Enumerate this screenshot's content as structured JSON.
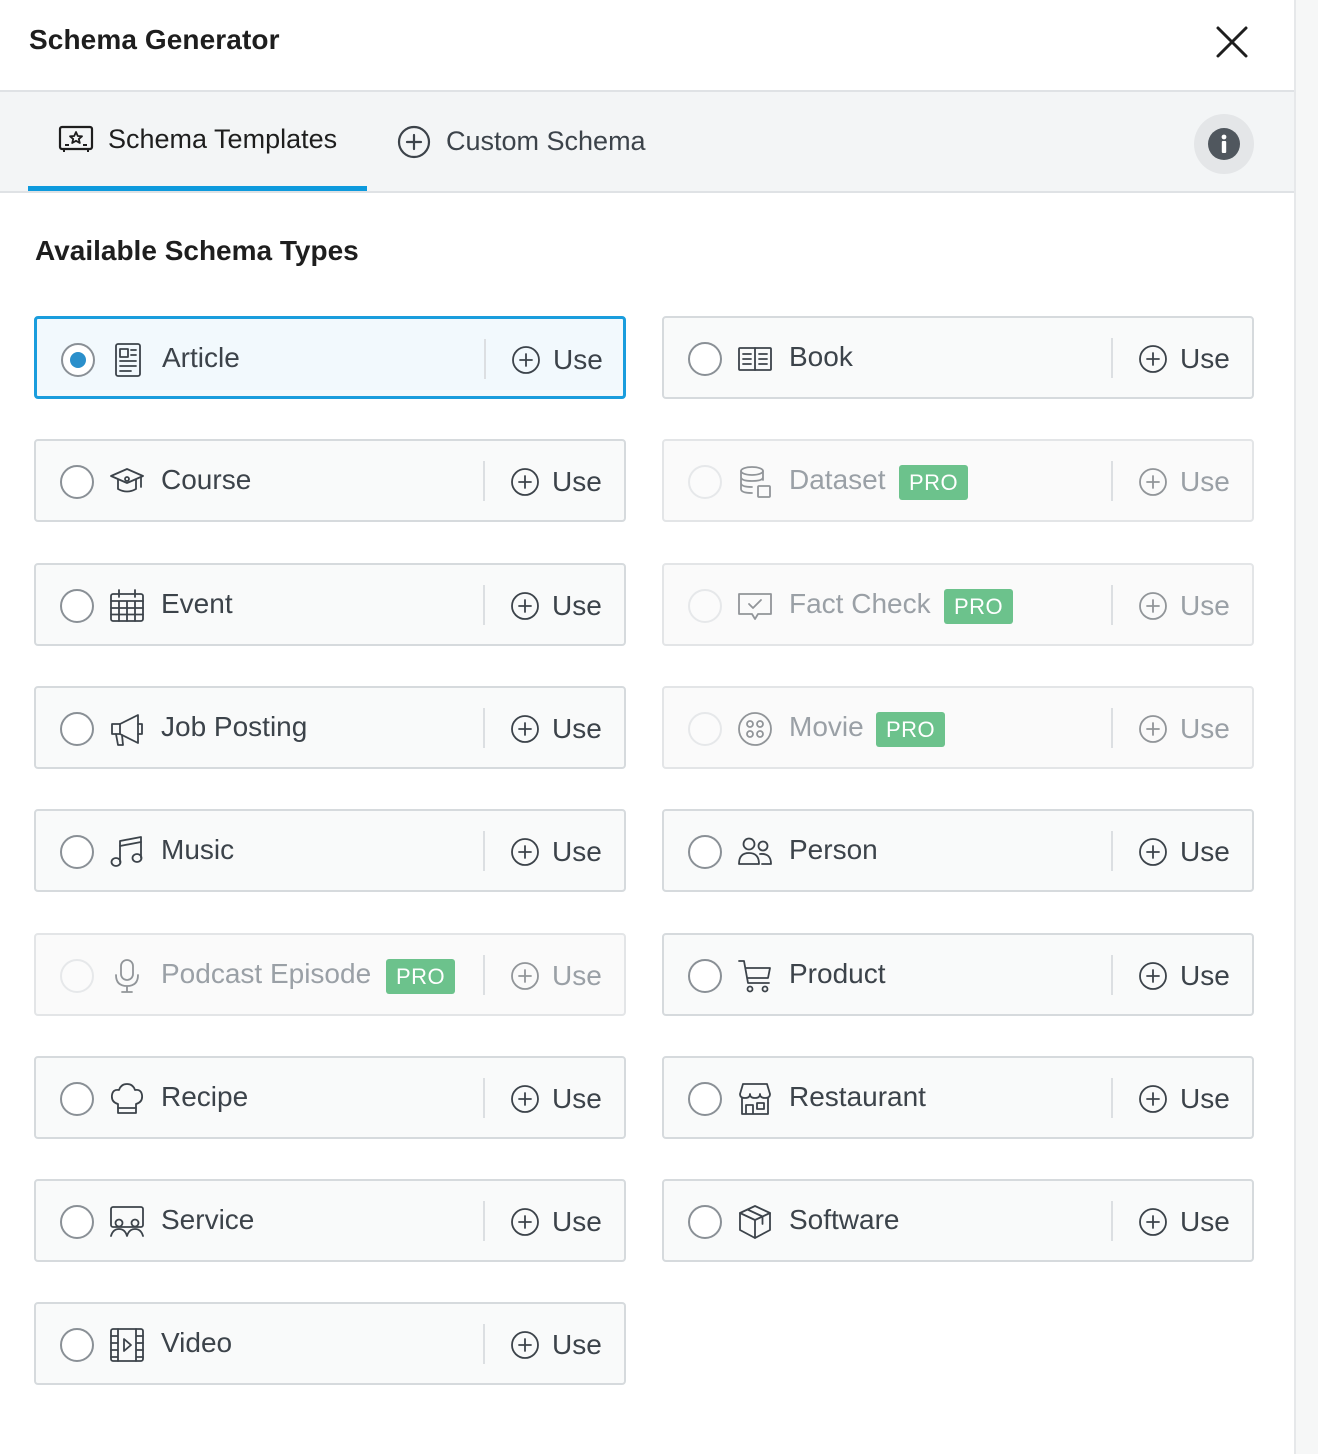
{
  "header": {
    "title": "Schema Generator"
  },
  "tabs": [
    {
      "label": "Schema Templates",
      "icon": "certificate-icon",
      "active": true
    },
    {
      "label": "Custom Schema",
      "icon": "plus-circle-icon",
      "active": false
    }
  ],
  "section": {
    "title": "Available Schema Types"
  },
  "pro_label": "PRO",
  "use_label": "Use",
  "colors": {
    "accent": "#0d9add",
    "pro_badge": "#6cc28c",
    "selected_bg": "#f2f9fd"
  },
  "schema_types": [
    {
      "name": "Article",
      "icon": "article-icon",
      "selected": true,
      "pro": false
    },
    {
      "name": "Book",
      "icon": "book-icon",
      "selected": false,
      "pro": false
    },
    {
      "name": "Course",
      "icon": "graduation-cap-icon",
      "selected": false,
      "pro": false
    },
    {
      "name": "Dataset",
      "icon": "database-icon",
      "selected": false,
      "pro": true
    },
    {
      "name": "Event",
      "icon": "calendar-icon",
      "selected": false,
      "pro": false
    },
    {
      "name": "Fact Check",
      "icon": "fact-check-icon",
      "selected": false,
      "pro": true
    },
    {
      "name": "Job Posting",
      "icon": "megaphone-icon",
      "selected": false,
      "pro": false
    },
    {
      "name": "Movie",
      "icon": "film-reel-icon",
      "selected": false,
      "pro": true
    },
    {
      "name": "Music",
      "icon": "music-note-icon",
      "selected": false,
      "pro": false
    },
    {
      "name": "Person",
      "icon": "people-icon",
      "selected": false,
      "pro": false
    },
    {
      "name": "Podcast Episode",
      "icon": "microphone-icon",
      "selected": false,
      "pro": true
    },
    {
      "name": "Product",
      "icon": "cart-icon",
      "selected": false,
      "pro": false
    },
    {
      "name": "Recipe",
      "icon": "chef-hat-icon",
      "selected": false,
      "pro": false
    },
    {
      "name": "Restaurant",
      "icon": "storefront-icon",
      "selected": false,
      "pro": false
    },
    {
      "name": "Service",
      "icon": "service-icon",
      "selected": false,
      "pro": false
    },
    {
      "name": "Software",
      "icon": "package-box-icon",
      "selected": false,
      "pro": false
    },
    {
      "name": "Video",
      "icon": "video-icon",
      "selected": false,
      "pro": false
    }
  ]
}
